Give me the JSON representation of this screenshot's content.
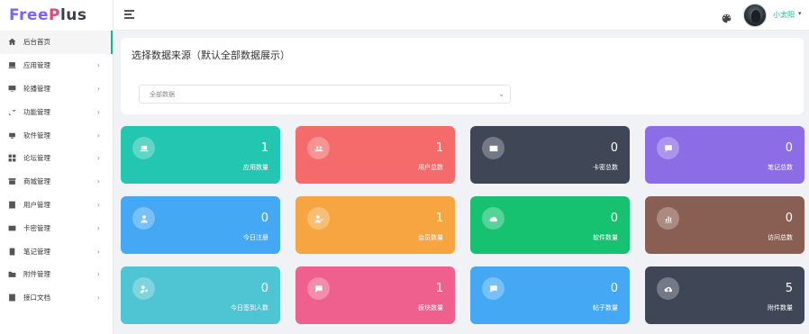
{
  "app": {
    "logo": {
      "part1": "Free",
      "part2": "P",
      "part3": "lus"
    }
  },
  "sidebar": {
    "items": [
      {
        "label": "后台首页",
        "icon": "home-icon",
        "active": true,
        "has_children": false
      },
      {
        "label": "应用管理",
        "icon": "app-icon",
        "active": false,
        "has_children": true
      },
      {
        "label": "轮播管理",
        "icon": "slideshow-icon",
        "active": false,
        "has_children": true
      },
      {
        "label": "功能管理",
        "icon": "tools-icon",
        "active": false,
        "has_children": true
      },
      {
        "label": "软件管理",
        "icon": "software-icon",
        "active": false,
        "has_children": true
      },
      {
        "label": "论坛管理",
        "icon": "forum-icon",
        "active": false,
        "has_children": true
      },
      {
        "label": "商城管理",
        "icon": "shop-icon",
        "active": false,
        "has_children": true
      },
      {
        "label": "用户管理",
        "icon": "user-icon",
        "active": false,
        "has_children": true
      },
      {
        "label": "卡密管理",
        "icon": "card-icon",
        "active": false,
        "has_children": true
      },
      {
        "label": "笔记管理",
        "icon": "note-icon",
        "active": false,
        "has_children": true
      },
      {
        "label": "附件管理",
        "icon": "folder-icon",
        "active": false,
        "has_children": true
      },
      {
        "label": "接口文档",
        "icon": "doc-icon",
        "active": false,
        "has_children": true
      }
    ],
    "chevron": "›"
  },
  "header": {
    "username": "小太阳",
    "caret": "▾"
  },
  "source": {
    "title": "选择数据来源（默认全部数据展示）",
    "selected": "全部数据",
    "chevron": "⌄"
  },
  "stats": [
    {
      "value": "1",
      "label": "应用数量",
      "color": "#23c6b0",
      "icon": "laptop-icon"
    },
    {
      "value": "1",
      "label": "用户总数",
      "color": "#f56b6b",
      "icon": "users-icon"
    },
    {
      "value": "0",
      "label": "卡密总数",
      "color": "#3f4756",
      "icon": "card-icon"
    },
    {
      "value": "0",
      "label": "笔记总数",
      "color": "#8c6de5",
      "icon": "comment-icon"
    },
    {
      "value": "0",
      "label": "今日注册",
      "color": "#45a8f5",
      "icon": "person-icon"
    },
    {
      "value": "1",
      "label": "会员数量",
      "color": "#f7a540",
      "icon": "person-check-icon"
    },
    {
      "value": "0",
      "label": "软件数量",
      "color": "#16c270",
      "icon": "cloud-icon"
    },
    {
      "value": "0",
      "label": "访问总数",
      "color": "#8a5f53",
      "icon": "bar-chart-icon"
    },
    {
      "value": "0",
      "label": "今日签到人数",
      "color": "#4fc4d2",
      "icon": "person-edit-icon"
    },
    {
      "value": "1",
      "label": "板块数量",
      "color": "#f0608f",
      "icon": "chat-icon"
    },
    {
      "value": "0",
      "label": "帖子数量",
      "color": "#45a8f5",
      "icon": "edit-message-icon"
    },
    {
      "value": "5",
      "label": "附件数量",
      "color": "#3f4756",
      "icon": "cloud-upload-icon"
    }
  ]
}
